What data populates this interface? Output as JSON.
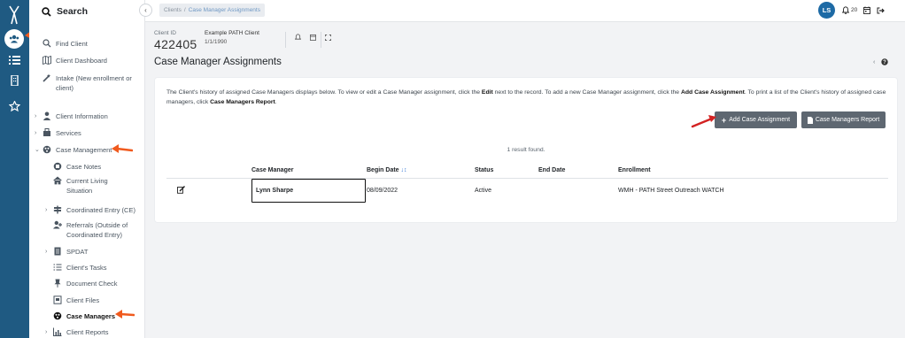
{
  "sidebar": {
    "search_label": "Search",
    "items": [
      {
        "label": "Find Client"
      },
      {
        "label": "Client Dashboard"
      },
      {
        "label": "Intake (New enrollment or client)"
      },
      {
        "label": "Client Information"
      },
      {
        "label": "Services"
      },
      {
        "label": "Case Management"
      },
      {
        "label": "Case Notes"
      },
      {
        "label": "Current Living Situation"
      },
      {
        "label": "Coordinated Entry (CE)"
      },
      {
        "label": "Referrals (Outside of Coordinated Entry)"
      },
      {
        "label": "SPDAT"
      },
      {
        "label": "Client's Tasks"
      },
      {
        "label": "Document Check"
      },
      {
        "label": "Client Files"
      },
      {
        "label": "Case Managers"
      },
      {
        "label": "Client Reports"
      }
    ]
  },
  "breadcrumb": {
    "root": "Clients",
    "sep": "/",
    "current": "Case Manager Assignments"
  },
  "user": {
    "initials": "LS",
    "notifications": "20"
  },
  "client": {
    "id_label": "Client ID",
    "id": "422405",
    "name": "Example PATH Client",
    "dob": "1/1/1990"
  },
  "page": {
    "title": "Case Manager Assignments"
  },
  "intro": {
    "p1": "The Client's history of assigned Case Managers displays below. To view or edit a Case Manager assignment, click the ",
    "b1": "Edit",
    "p2": " next to the record. To add a new Case Manager assignment, click the ",
    "b2": "Add Case Assignment",
    "p3": ".  To print a list of the Client's history of assigned case managers, click ",
    "b3": "Case Managers Report",
    "p4": "."
  },
  "buttons": {
    "add": "Add Case Assignment",
    "report": "Case Managers Report"
  },
  "result_count": "1 result found.",
  "table": {
    "headers": {
      "case_manager": "Case Manager",
      "begin_date": "Begin Date",
      "status": "Status",
      "end_date": "End Date",
      "enrollment": "Enrollment"
    },
    "rows": [
      {
        "case_manager": "Lynn Sharpe",
        "begin_date": "08/09/2022",
        "status": "Active",
        "end_date": "",
        "enrollment": "WMH - PATH Street Outreach WATCH"
      }
    ]
  },
  "colors": {
    "rail": "#1f5a82",
    "avatar": "#1d6aa5",
    "button": "#5e6771",
    "arrow_orange": "#f05a1e",
    "arrow_red": "#d32222"
  }
}
